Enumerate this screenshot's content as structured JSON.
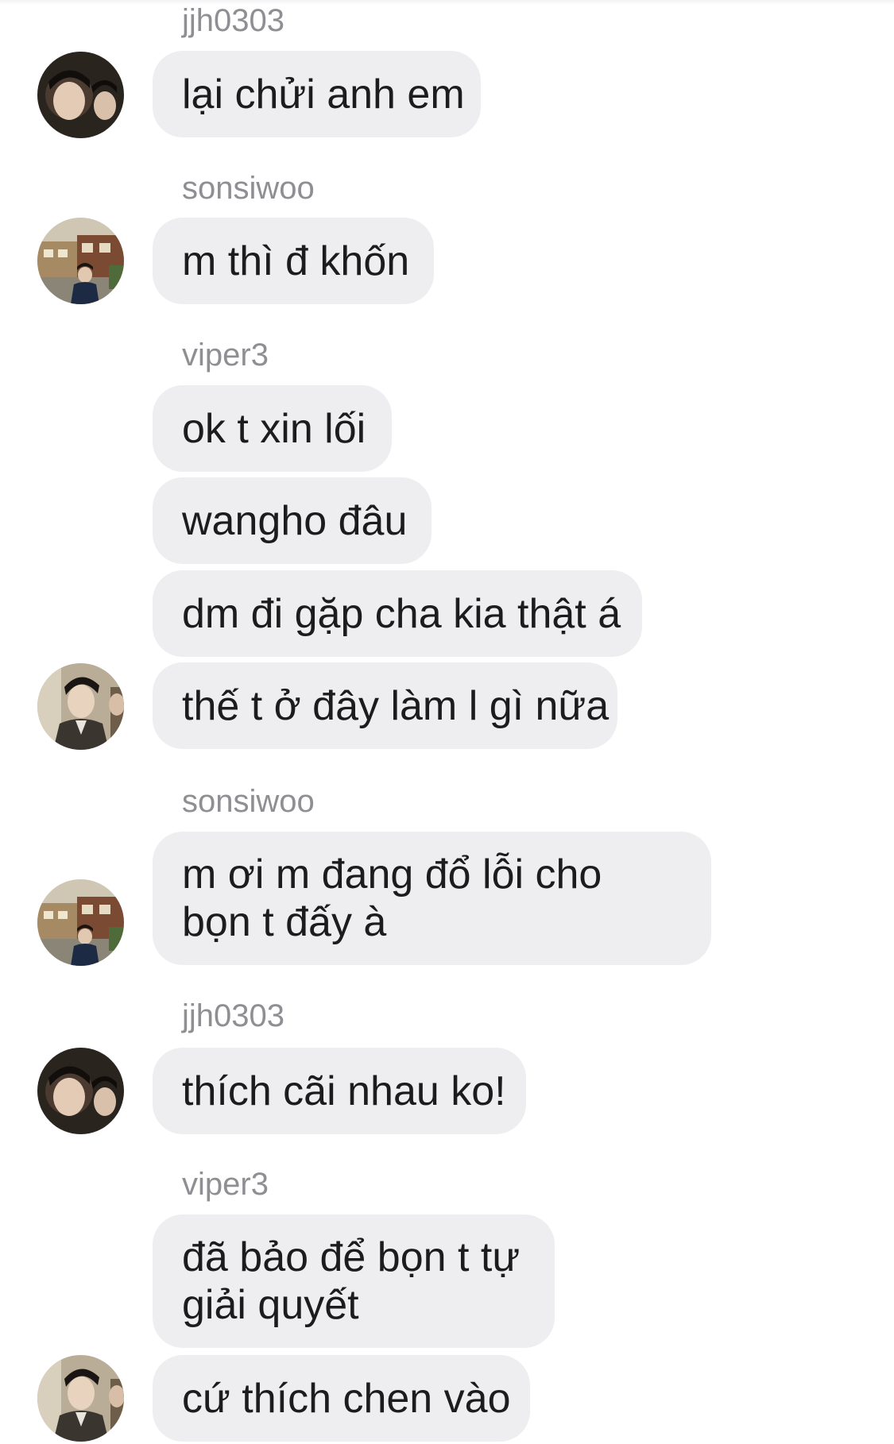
{
  "messages": [
    {
      "sender": "jjh0303",
      "avatar": "dark-portrait-avatar",
      "bubbles": [
        "lại chửi anh em"
      ]
    },
    {
      "sender": "sonsiwoo",
      "avatar": "street-photo-avatar",
      "bubbles": [
        "m thì đ khốn"
      ]
    },
    {
      "sender": "viper3",
      "avatar": "suit-portrait-avatar",
      "bubbles": [
        "ok t xin lối",
        "wangho đâu",
        "dm đi gặp cha kia thật á",
        "thế t ở đây làm l gì nữa"
      ]
    },
    {
      "sender": "sonsiwoo",
      "avatar": "street-photo-avatar",
      "bubbles": [
        "m ơi m đang đổ lỗi cho bọn t đấy à"
      ]
    },
    {
      "sender": "jjh0303",
      "avatar": "dark-portrait-avatar",
      "bubbles": [
        "thích cãi nhau ko!"
      ]
    },
    {
      "sender": "viper3",
      "avatar": "suit-portrait-avatar",
      "bubbles": [
        "đã bảo để bọn t tự giải quyết",
        "cứ thích chen vào"
      ]
    }
  ],
  "colors": {
    "bubble_bg": "#eeeef0",
    "sender_text": "#8e8e93",
    "message_text": "#1c1c1e"
  }
}
